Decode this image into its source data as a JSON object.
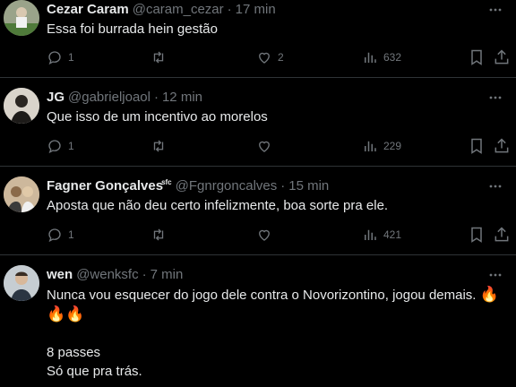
{
  "tweets": [
    {
      "name": "Cezar Caram",
      "badge": "",
      "handle": "@caram_cezar",
      "time": "17 min",
      "text": "Essa foi burrada hein gestão",
      "replies": "1",
      "retweets": "",
      "likes": "2",
      "views": "632"
    },
    {
      "name": "JG",
      "badge": "",
      "handle": "@gabrieljoaol",
      "time": "12 min",
      "text": "Que isso de um incentivo ao morelos",
      "replies": "1",
      "retweets": "",
      "likes": "",
      "views": "229"
    },
    {
      "name": "Fagner Gonçalves",
      "badge": "sfc",
      "handle": "@Fgnrgoncalves",
      "time": "15 min",
      "text": "Aposta que não deu certo infelizmente, boa sorte pra ele.",
      "replies": "1",
      "retweets": "",
      "likes": "",
      "views": "421"
    },
    {
      "name": "wen",
      "badge": "",
      "handle": "@wenksfc",
      "time": "7 min",
      "text_line1": "Nunca vou esquecer do jogo dele contra o Novorizontino, jogou demais.",
      "text_line3": "8 passes",
      "text_line4": "Só  que pra trás."
    }
  ],
  "colors": {
    "background": "#000000",
    "text": "#e7e9ea",
    "muted": "#71767b",
    "divider": "#2f3336"
  },
  "icons": [
    "reply-icon",
    "retweet-icon",
    "like-icon",
    "views-icon",
    "bookmark-icon",
    "share-icon",
    "more-icon",
    "fire-emoji"
  ]
}
